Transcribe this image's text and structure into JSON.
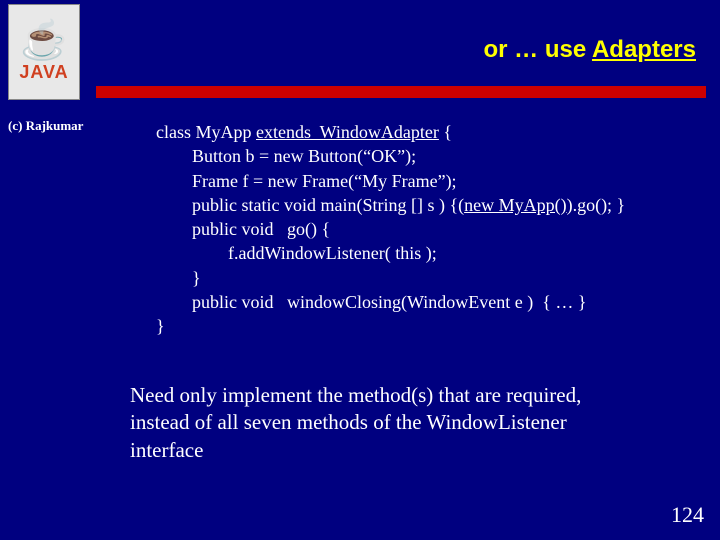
{
  "logo": {
    "text": "JAVA"
  },
  "title": {
    "prefix": "or … use ",
    "adapters": "Adapters"
  },
  "copyright": "(c) Rajkumar",
  "code": {
    "l1a": "class MyApp ",
    "l1b": "extends  WindowAdapter",
    "l1c": " {",
    "l2": "        Button b = new Button(“OK”);",
    "l3": "        Frame f = new Frame(“My Frame”);",
    "l4a": "        public static void main(String [] s ) {(",
    "l4b": "new MyApp()",
    "l4c": ").go(); }",
    "l5": "        public void   go() {",
    "l6": "                f.addWindowListener( this );",
    "l7": "        }",
    "l8": "        public void   windowClosing(WindowEvent e )  { … }",
    "l9": "}"
  },
  "note": "Need only implement the method(s) that are required, instead of all seven methods of the WindowListener interface",
  "pageNumber": "124"
}
